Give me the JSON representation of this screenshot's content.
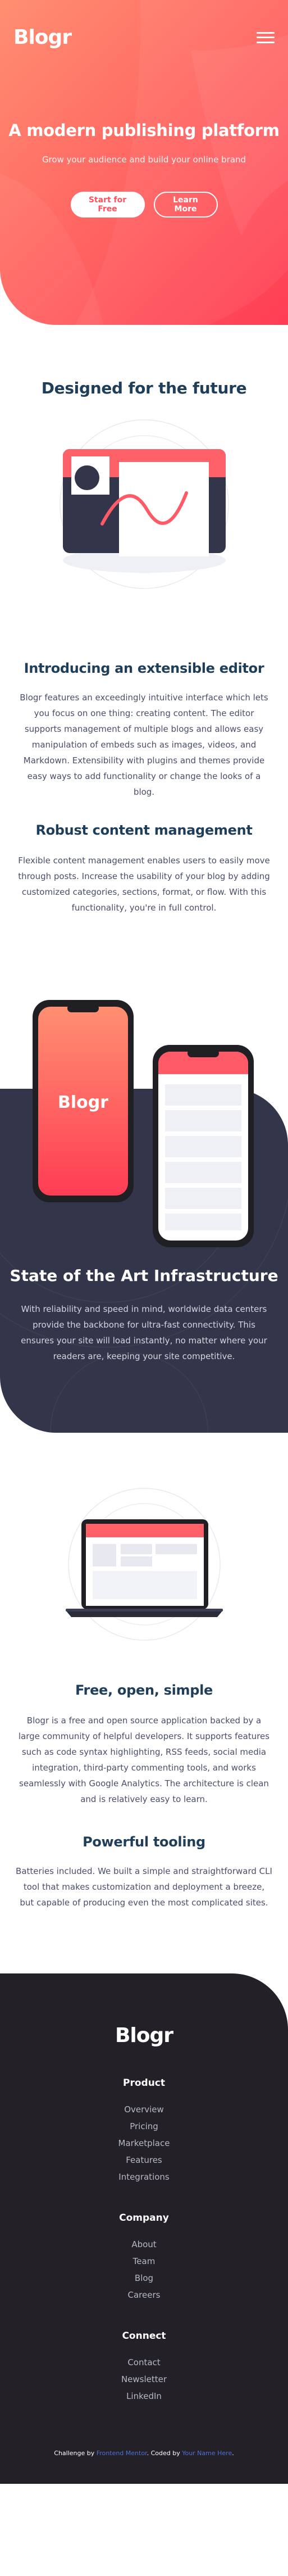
{
  "brand": {
    "logo": "Blogr"
  },
  "colors": {
    "hero_gradient_start": "#ff8f71",
    "hero_gradient_end": "#ff3d54",
    "heading": "#1f3e5a",
    "body_text": "#4a4e6a",
    "dark_section": "#33354a",
    "footer_bg": "#232127",
    "link_blue": "#4d6fd8"
  },
  "header": {
    "menu_icon": "hamburger-icon"
  },
  "hero": {
    "title": "A modern publishing platform",
    "subtitle": "Grow your audience and build your online brand",
    "primary_button": "Start for Free",
    "secondary_button": "Learn More"
  },
  "design": {
    "title": "Designed for the future",
    "editor_title": "Introducing an extensible editor",
    "editor_text": "Blogr features an exceedingly intuitive interface which lets you focus on one thing: creating content. The editor supports management of multiple blogs and allows easy manipulation of embeds such as images, videos, and Markdown. Extensibility with plugins and themes provide easy ways to add functionality or change the looks of a blog.",
    "cms_title": "Robust content management",
    "cms_text": "Flexible content management enables users to easily move through posts. Increase the usability of your blog by adding customized categories, sections, format, or flow. With this functionality, you're in full control."
  },
  "infrastructure": {
    "phone_logo": "Blogr",
    "title": "State of the Art Infrastructure",
    "text": "With reliability and speed in mind, worldwide data centers provide the backbone for ultra-fast connectivity. This ensures your site will load instantly, no matter where your readers are, keeping your site competitive."
  },
  "features": {
    "free_title": "Free, open, simple",
    "free_text": "Blogr is a free and open source application backed by a large community of helpful developers. It supports features such as code syntax highlighting, RSS feeds, social media integration, third-party commenting tools, and works seamlessly with Google Analytics. The architecture is clean and is relatively easy to learn.",
    "tool_title": "Powerful tooling",
    "tool_text": "Batteries included. We built a simple and straightforward CLI tool that makes customization and deployment a breeze, but capable of producing even the most complicated sites."
  },
  "footer": {
    "logo": "Blogr",
    "columns": [
      {
        "title": "Product",
        "links": [
          "Overview",
          "Pricing",
          "Marketplace",
          "Features",
          "Integrations"
        ]
      },
      {
        "title": "Company",
        "links": [
          "About",
          "Team",
          "Blog",
          "Careers"
        ]
      },
      {
        "title": "Connect",
        "links": [
          "Contact",
          "Newsletter",
          "LinkedIn"
        ]
      }
    ],
    "attribution": {
      "prefix": "Challenge by ",
      "challenge_link": "Frontend Mentor",
      "middle": ". Coded by ",
      "author_link": "Your Name Here",
      "suffix": "."
    }
  }
}
